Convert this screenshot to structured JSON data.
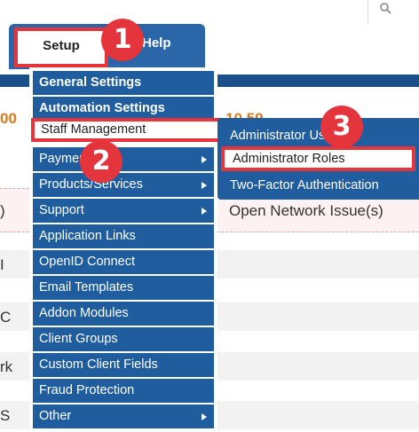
{
  "header": {
    "tabs": [
      {
        "label": "Setup"
      },
      {
        "label": "Help"
      }
    ]
  },
  "background": {
    "snippets": [
      "00",
      "10,59",
      "...",
      "Open Network Issue(s)",
      ")",
      "I",
      "C",
      "rk",
      "S"
    ]
  },
  "setup_menu": {
    "items": [
      {
        "label": "General Settings",
        "submenu": false
      },
      {
        "label": "Automation Settings",
        "submenu": false
      },
      {
        "label": "Staff Management",
        "submenu": true
      },
      {
        "label": "Payments",
        "submenu": true
      },
      {
        "label": "Products/Services",
        "submenu": true
      },
      {
        "label": "Support",
        "submenu": true
      },
      {
        "label": "Application Links",
        "submenu": false
      },
      {
        "label": "OpenID Connect",
        "submenu": false
      },
      {
        "label": "Email Templates",
        "submenu": false
      },
      {
        "label": "Addon Modules",
        "submenu": false
      },
      {
        "label": "Client Groups",
        "submenu": false
      },
      {
        "label": "Custom Client Fields",
        "submenu": false
      },
      {
        "label": "Fraud Protection",
        "submenu": false
      },
      {
        "label": "Other",
        "submenu": true
      }
    ]
  },
  "staff_submenu": {
    "items": [
      {
        "label": "Administrator Users"
      },
      {
        "label": "Administrator Roles"
      },
      {
        "label": "Two-Factor Authentication"
      }
    ]
  },
  "badges": [
    "1",
    "2",
    "3"
  ],
  "colors": {
    "nav_blue": "#2a66a8",
    "menu_blue": "#1f5d9e",
    "highlight_red": "#e4343c",
    "alert_bg": "#fdf1f1"
  }
}
